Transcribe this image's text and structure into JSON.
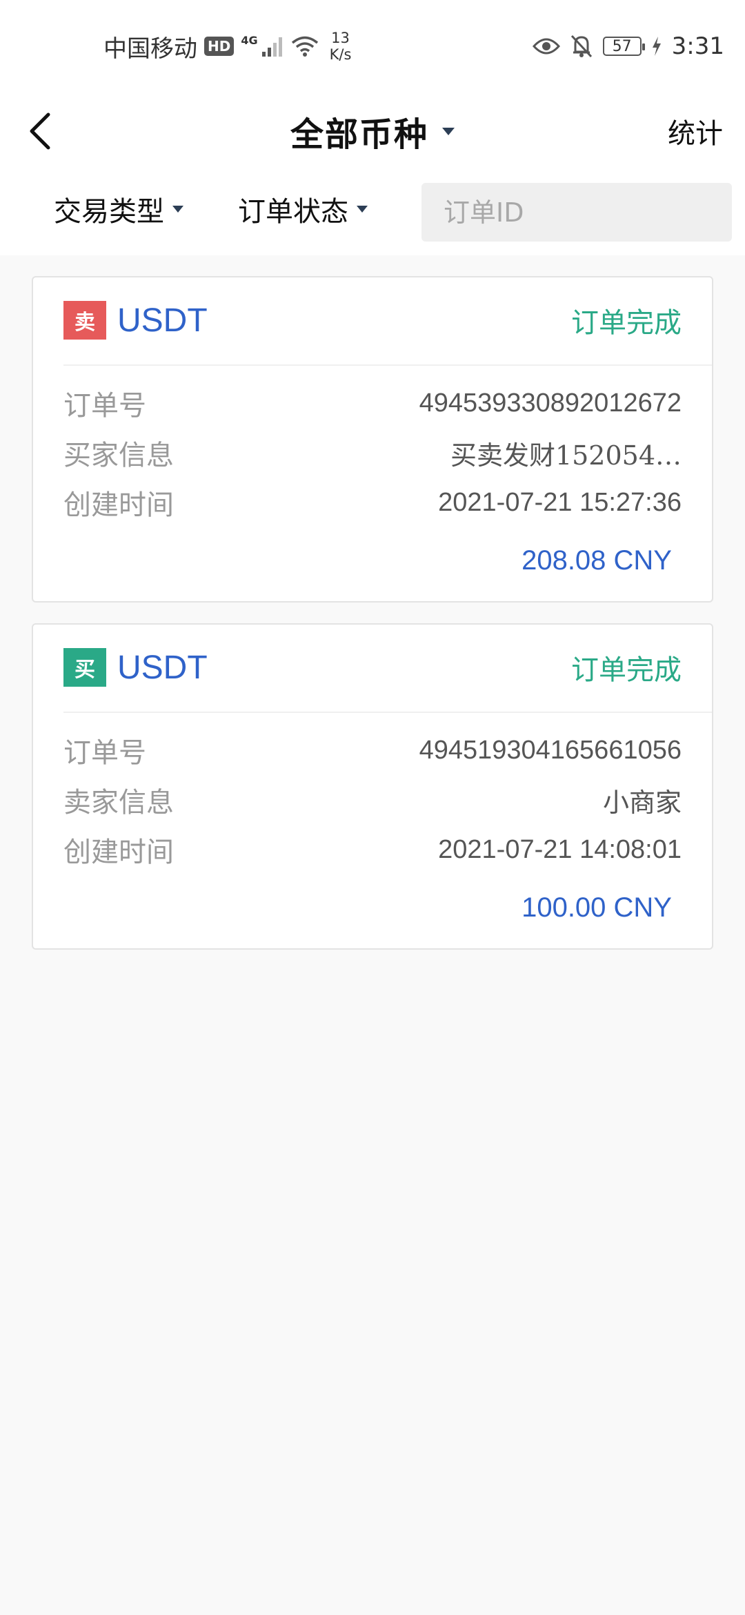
{
  "status_bar": {
    "carrier": "中国移动",
    "hd": "HD",
    "network": "4G",
    "speed_value": "13",
    "speed_unit": "K/s",
    "battery": "57",
    "time": "3:31"
  },
  "nav": {
    "title": "全部币种",
    "stats_label": "统计"
  },
  "filters": {
    "trade_type_label": "交易类型",
    "order_status_label": "订单状态",
    "order_id_placeholder": "订单ID"
  },
  "colors": {
    "accent_blue": "#2f62c9",
    "status_green": "#2aa987",
    "sell_red": "#e65a5a",
    "buy_green": "#2aa987"
  },
  "orders": [
    {
      "type_tag": "卖",
      "type_color": "#e65a5a",
      "coin": "USDT",
      "status": "订单完成",
      "rows": [
        {
          "label": "订单号",
          "value": "494539330892012672"
        },
        {
          "label": "买家信息",
          "value": "买卖发财152054…"
        },
        {
          "label": "创建时间",
          "value": "2021-07-21 15:27:36"
        }
      ],
      "amount": "208.08 CNY"
    },
    {
      "type_tag": "买",
      "type_color": "#2aa987",
      "coin": "USDT",
      "status": "订单完成",
      "rows": [
        {
          "label": "订单号",
          "value": "494519304165661056"
        },
        {
          "label": "卖家信息",
          "value": "小商家"
        },
        {
          "label": "创建时间",
          "value": "2021-07-21 14:08:01"
        }
      ],
      "amount": "100.00 CNY"
    }
  ]
}
